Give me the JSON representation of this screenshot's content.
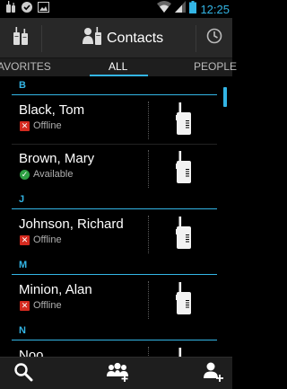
{
  "status_bar": {
    "time": "12:25",
    "left_icons": [
      "radio-app-icon",
      "check-circle-icon",
      "picture-icon"
    ],
    "right_icons": [
      "wifi-icon",
      "signal-icon",
      "battery-icon"
    ]
  },
  "action_bar": {
    "title": "Contacts",
    "home_icon": "radio-app-icon",
    "title_icon": "contacts-radio-icon",
    "right_icon": "clock-icon"
  },
  "tabs": [
    {
      "label": "AVORITES",
      "active": false
    },
    {
      "label": "ALL",
      "active": true
    },
    {
      "label": "PEOPLE",
      "active": false
    }
  ],
  "sections": [
    {
      "letter": "B",
      "contacts": [
        {
          "name": "Black, Tom",
          "status": "Offline"
        },
        {
          "name": "Brown, Mary",
          "status": "Available"
        }
      ]
    },
    {
      "letter": "J",
      "contacts": [
        {
          "name": "Johnson, Richard",
          "status": "Offline"
        }
      ]
    },
    {
      "letter": "M",
      "contacts": [
        {
          "name": "Minion, Alan",
          "status": "Offline"
        }
      ]
    },
    {
      "letter": "N",
      "contacts": [
        {
          "name": "Noo",
          "status": ""
        }
      ]
    }
  ],
  "bottom_bar": {
    "icons": [
      "search-icon",
      "add-group-icon",
      "add-contact-icon"
    ]
  },
  "colors": {
    "accent": "#33b5e5",
    "offline": "#d42a1f",
    "available": "#2ea043",
    "action_bar": "#282828"
  }
}
